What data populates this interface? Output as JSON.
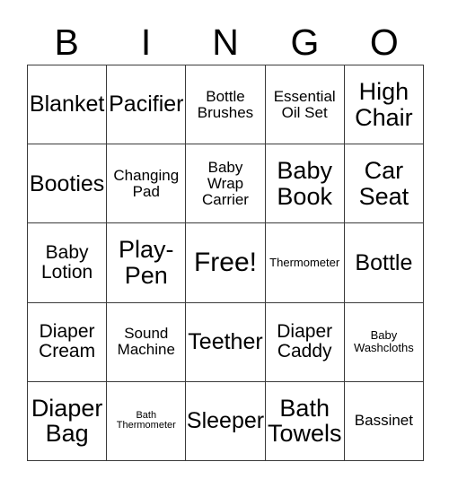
{
  "header": {
    "letters": [
      "B",
      "I",
      "N",
      "G",
      "O"
    ]
  },
  "grid": {
    "rows": 5,
    "columns": 5,
    "cells": [
      {
        "label": "Blanket",
        "size": "lg"
      },
      {
        "label": "Pacifier",
        "size": "lg"
      },
      {
        "label": "Bottle\nBrushes",
        "size": "sm"
      },
      {
        "label": "Essential\nOil Set",
        "size": "sm"
      },
      {
        "label": "High\nChair",
        "size": "xl"
      },
      {
        "label": "Booties",
        "size": "lg"
      },
      {
        "label": "Changing\nPad",
        "size": "sm"
      },
      {
        "label": "Baby\nWrap\nCarrier",
        "size": "sm"
      },
      {
        "label": "Baby\nBook",
        "size": "xl"
      },
      {
        "label": "Car\nSeat",
        "size": "xl"
      },
      {
        "label": "Baby\nLotion",
        "size": "md"
      },
      {
        "label": "Play-\nPen",
        "size": "xl"
      },
      {
        "label": "Free!",
        "size": "free"
      },
      {
        "label": "Thermometer",
        "size": "xs"
      },
      {
        "label": "Bottle",
        "size": "lg"
      },
      {
        "label": "Diaper\nCream",
        "size": "md"
      },
      {
        "label": "Sound\nMachine",
        "size": "sm"
      },
      {
        "label": "Teether",
        "size": "lg"
      },
      {
        "label": "Diaper\nCaddy",
        "size": "md"
      },
      {
        "label": "Baby\nWashcloths",
        "size": "xs"
      },
      {
        "label": "Diaper\nBag",
        "size": "xl"
      },
      {
        "label": "Bath\nThermometer",
        "size": "xxs"
      },
      {
        "label": "Sleeper",
        "size": "lg"
      },
      {
        "label": "Bath\nTowels",
        "size": "xl"
      },
      {
        "label": "Bassinet",
        "size": "sm"
      }
    ]
  },
  "colors": {
    "background": "#ffffff",
    "border": "#3a3a3a",
    "text": "#000000"
  }
}
